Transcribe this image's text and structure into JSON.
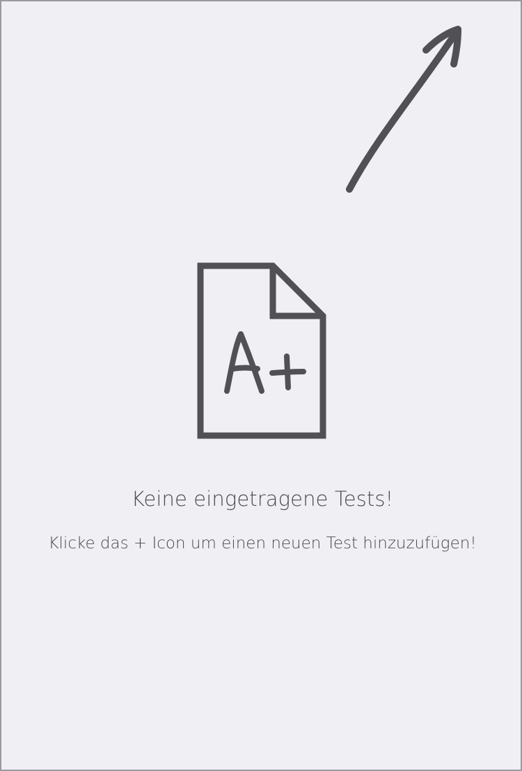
{
  "empty_state": {
    "title": "Keine eingetragene Tests!",
    "subtitle": "Klicke das + Icon um einen neuen Test hinzuzufügen!",
    "illustration_icon": "grade-document-icon",
    "hint_icon": "hand-drawn-arrow-icon"
  },
  "colors": {
    "background": "#efeff4",
    "icon": "#505055",
    "text": "#4a4a4e"
  }
}
